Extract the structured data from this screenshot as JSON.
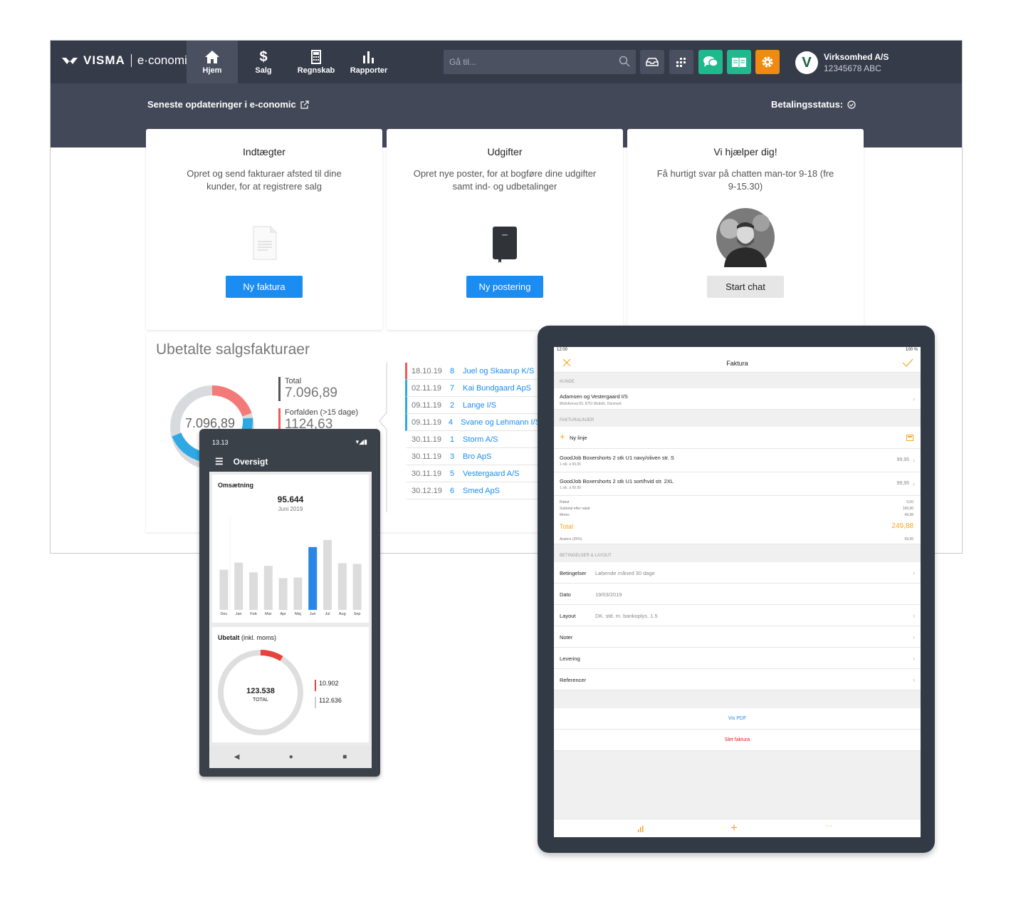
{
  "desktop": {
    "brand": {
      "visma": "VISMA",
      "product": "e·conomic"
    },
    "nav": [
      {
        "label": "Hjem",
        "icon": "home-icon"
      },
      {
        "label": "Salg",
        "icon": "dollar-icon"
      },
      {
        "label": "Regnskab",
        "icon": "calculator-icon"
      },
      {
        "label": "Rapporter",
        "icon": "bar-chart-icon"
      }
    ],
    "search": {
      "placeholder": "Gå til..."
    },
    "toolbar_colors": {
      "inbox": "#4b5060",
      "apps": "#4b5060",
      "chat": "#1fb98d",
      "help": "#1fb98d",
      "settings": "#f08a12"
    },
    "org": {
      "name": "Virksomhed A/S",
      "id": "12345678 ABC",
      "avatar_letter": "V"
    },
    "updates_link": "Seneste opdateringer i e-conomic",
    "payment_status": "Betalingsstatus:",
    "cards": [
      {
        "title": "Indtægter",
        "text": "Opret og send fakturaer afsted til dine kunder, for at registrere salg",
        "button": "Ny faktura"
      },
      {
        "title": "Udgifter",
        "text": "Opret nye poster, for at bogføre dine udgifter samt ind- og udbetalinger",
        "button": "Ny postering"
      },
      {
        "title": "Vi hjælper dig!",
        "text": "Få hurtigt svar på chatten man-tor 9-18 (fre 9-15.30)",
        "button": "Start chat"
      }
    ],
    "unpaid": {
      "title": "Ubetalte salgsfakturaer",
      "donut_total": "7.096,89",
      "legend": [
        {
          "label": "Total",
          "value": "7.096,89",
          "color": "#555555"
        },
        {
          "label": "Forfalden (>15 dage)",
          "value": "1124,63",
          "color": "#f25a5a"
        }
      ],
      "invoices": [
        {
          "date": "18.10.19",
          "num": "8",
          "customer": "Juel og Skaarup K/S",
          "overdue": true
        },
        {
          "date": "02.11.19",
          "num": "7",
          "customer": "Kai Bundgaard ApS",
          "overdue": false
        },
        {
          "date": "09.11.19",
          "num": "2",
          "customer": "Lange I/S",
          "overdue": false
        },
        {
          "date": "09.11.19",
          "num": "4",
          "customer": "Svane og Lehmann I/S",
          "overdue": false
        },
        {
          "date": "30.11.19",
          "num": "1",
          "customer": "Storm A/S",
          "overdue": false
        },
        {
          "date": "30.11.19",
          "num": "3",
          "customer": "Bro ApS",
          "overdue": false
        },
        {
          "date": "30.11.19",
          "num": "5",
          "customer": "Vestergaard A/S",
          "overdue": false
        },
        {
          "date": "30.12.19",
          "num": "6",
          "customer": "Smed ApS",
          "overdue": false
        }
      ]
    }
  },
  "phone": {
    "time": "13.13",
    "title": "Oversigt",
    "revenue": {
      "label": "Omsætning",
      "value": "95.644",
      "period": "Juni 2019"
    },
    "chart_data": {
      "type": "bar",
      "categories": [
        "Dec",
        "Jan",
        "Feb",
        "Mar",
        "Apr",
        "Maj",
        "Jun",
        "Jul",
        "Aug",
        "Sep"
      ],
      "values": [
        62,
        73,
        58,
        68,
        49,
        50,
        97,
        108,
        72,
        71
      ],
      "highlight": "Jun",
      "year_label": "2019"
    },
    "unpaid": {
      "label_bold": "Ubetalt",
      "label_rest": " (inkl. moms)",
      "total": "123.538",
      "total_label": "TOTAL",
      "overdue": "10.902",
      "current": "112.636",
      "overdue_fraction": 0.088
    }
  },
  "tablet": {
    "time": "12:00",
    "battery": "100 %",
    "title": "Faktura",
    "section_customer": "KUNDE",
    "customer": {
      "name": "Adamsen og Vestergaard I/S",
      "address": "Østlofisevej 83, 8752 Østbirk, Danmark"
    },
    "section_lines": "FAKTURALINJER",
    "new_line": "Ny linje",
    "lines": [
      {
        "name": "GoodJob  Boxershorts 2 stk U1 navy/oliven str. S",
        "sub": "1 stk. á 99,95",
        "amount": "99,95"
      },
      {
        "name": "GoodJob  Boxershorts 2 stk U1 sort/hvid str. 2XL",
        "sub": "1 stk. á 99,95",
        "amount": "99,95"
      }
    ],
    "totals": [
      {
        "label": "Rabat",
        "value": "0,00"
      },
      {
        "label": "Subtotal efter rabat",
        "value": "199,90"
      },
      {
        "label": "Moms",
        "value": "49,98"
      }
    ],
    "total": {
      "label": "Total",
      "value": "249,88"
    },
    "avance": {
      "label": "Avance (25%)",
      "value": "59,95"
    },
    "section_terms": "BETINGELSER & LAYOUT",
    "terms": [
      {
        "label": "Betingelser",
        "value": "Løbende måned 30 dage"
      },
      {
        "label": "Dato",
        "value": "19/03/2019"
      },
      {
        "label": "Layout",
        "value": "DK. std. m. bankoplys. 1.5"
      },
      {
        "label": "Noter",
        "value": ""
      },
      {
        "label": "Levering",
        "value": ""
      },
      {
        "label": "Referencer",
        "value": ""
      }
    ],
    "show_pdf": "Vis PDF",
    "delete": "Slet faktura",
    "accent": "#f5a623"
  }
}
